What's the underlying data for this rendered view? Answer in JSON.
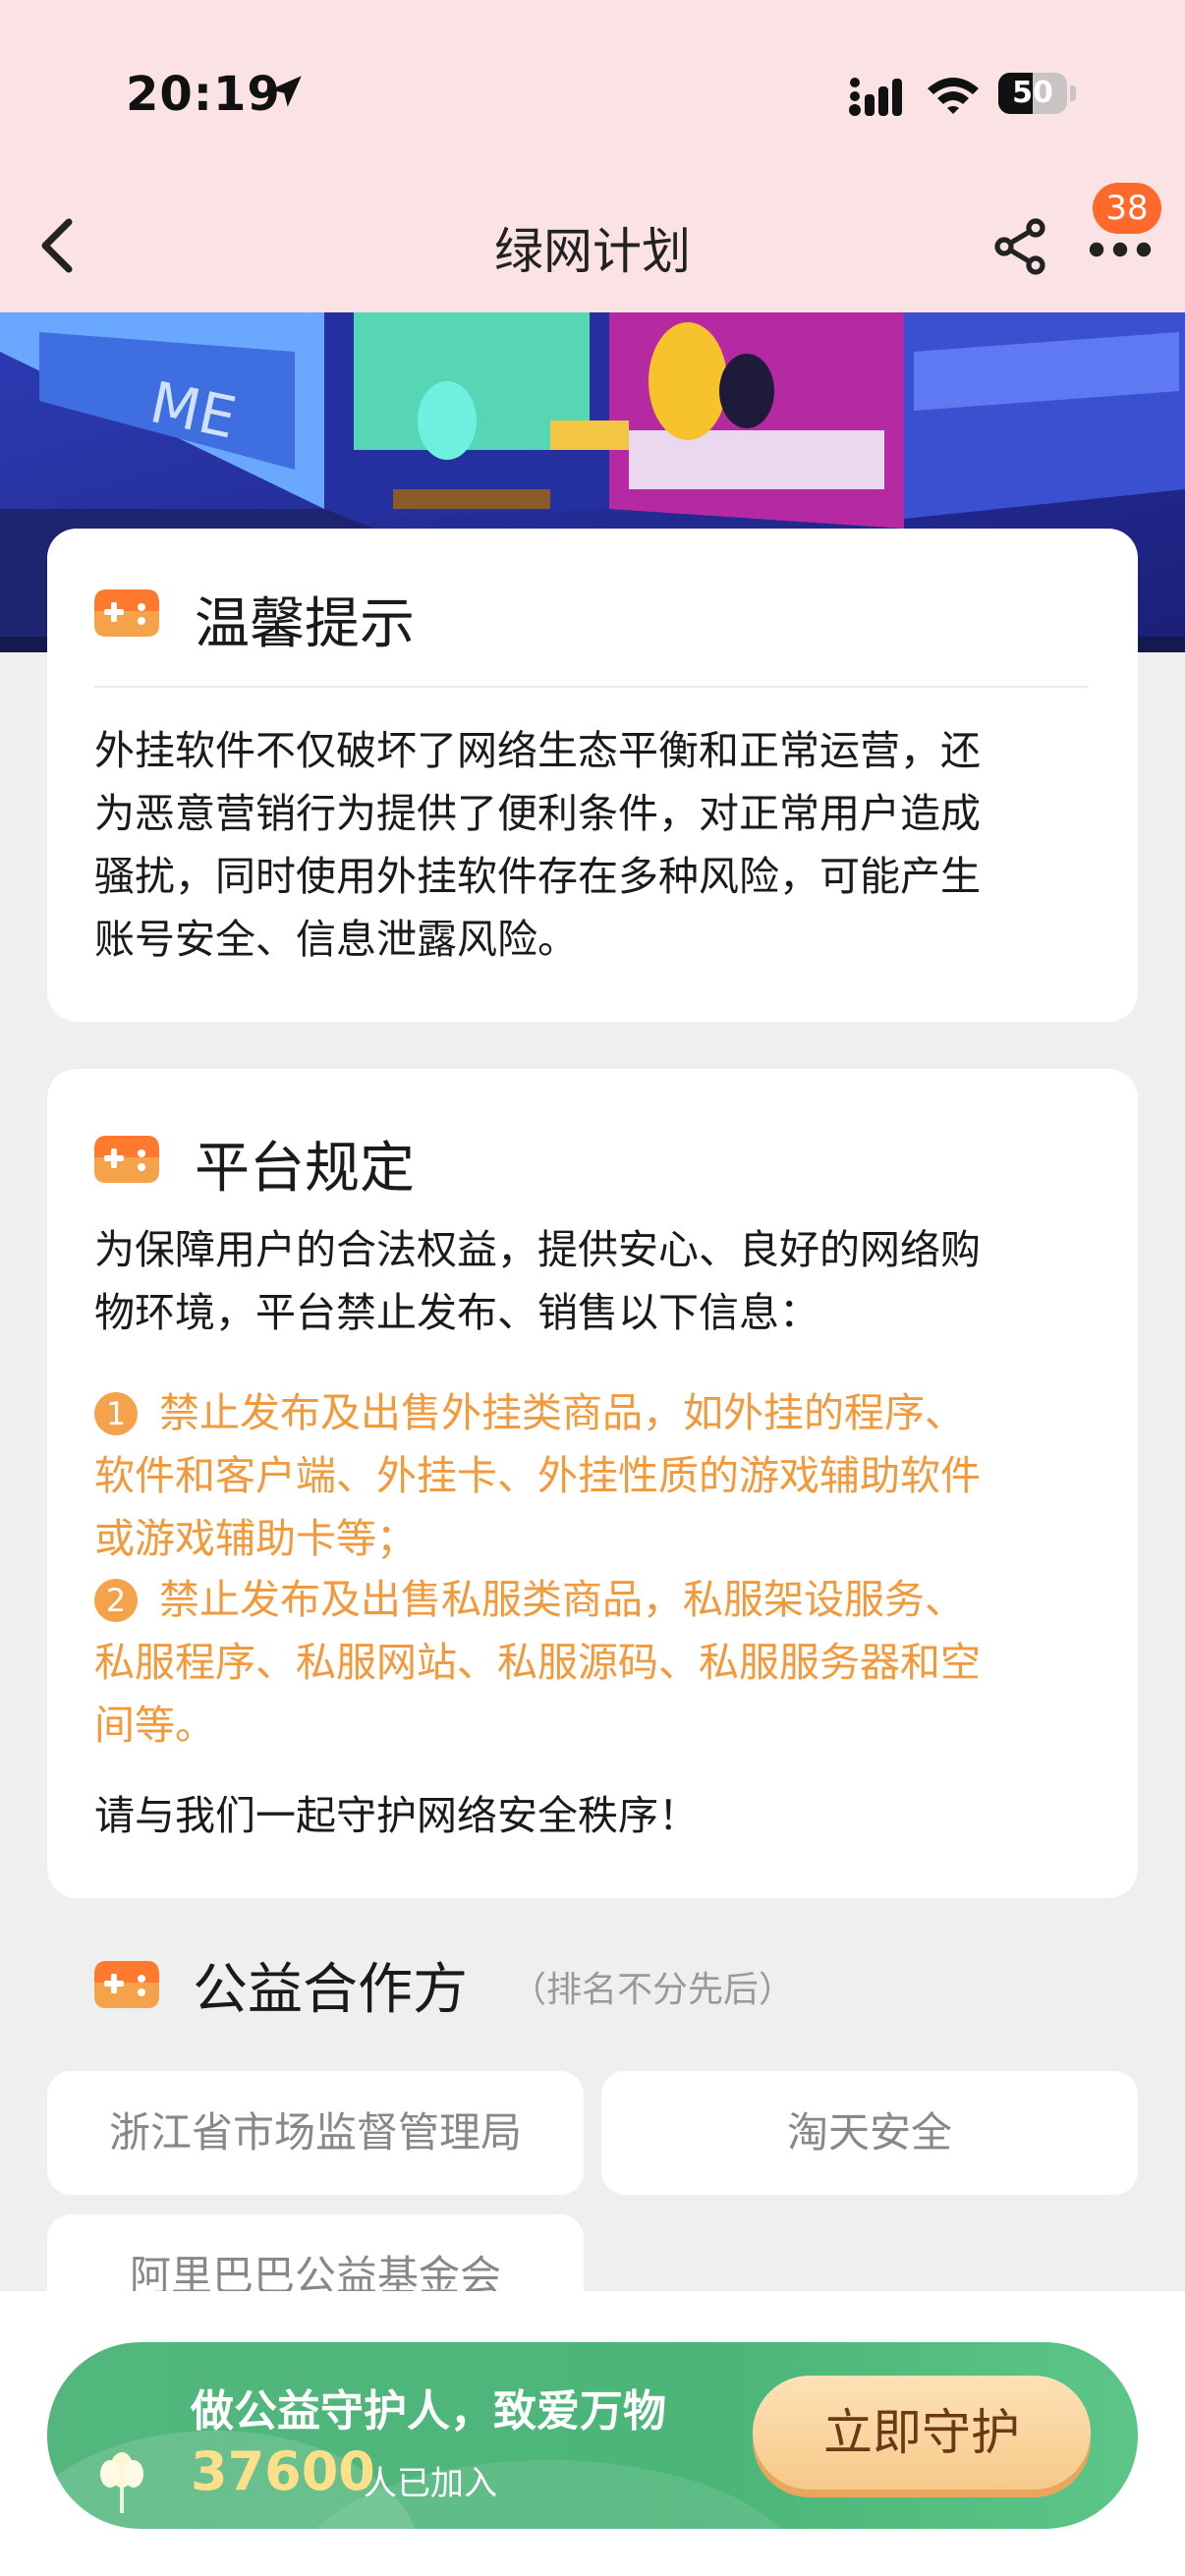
{
  "status_bar": {
    "time": "20:19",
    "battery": "50",
    "battery_level": 0.5
  },
  "nav": {
    "title": "绿网计划",
    "badge": "38"
  },
  "tip_card": {
    "title": "温馨提示",
    "lines": [
      "外挂软件不仅破坏了网络生态平衡和正常运营，还",
      "为恶意营销行为提供了便利条件，对正常用户造成",
      "骚扰，同时使用外挂软件存在多种风险，可能产生",
      "账号安全、信息泄露风险。"
    ]
  },
  "rules_card": {
    "title": "平台规定",
    "intro_lines": [
      "为保障用户的合法权益，提供安心、良好的网络购",
      "物环境，平台禁止发布、销售以下信息："
    ],
    "rules": [
      {
        "num": "1",
        "lines": [
          "禁止发布及出售外挂类商品，如外挂的程序、",
          "软件和客户端、外挂卡、外挂性质的游戏辅助软件",
          "或游戏辅助卡等；"
        ]
      },
      {
        "num": "2",
        "lines": [
          "禁止发布及出售私服类商品，私服架设服务、",
          "私服程序、私服网站、私服源码、私服服务器和空",
          "间等。"
        ]
      }
    ],
    "closing": "请与我们一起守护网络安全秩序！"
  },
  "partners": {
    "title": "公益合作方",
    "note": "（排名不分先后）",
    "items": [
      "浙江省市场监督管理局",
      "淘天安全",
      "阿里巴巴公益基金会"
    ]
  },
  "cta": {
    "title": "做公益守护人，致爱万物",
    "count": "37600",
    "count_suffix": "人已加入",
    "button": "立即守护"
  },
  "colors": {
    "header_bg": "#fbe2e4",
    "page_bg": "#efefef",
    "accent_orange": "#f29a3b",
    "cta_green": "#4bb578"
  },
  "icons": [
    "location-arrow-icon",
    "signal-icon",
    "wifi-icon",
    "battery-icon",
    "back-icon",
    "share-icon",
    "more-icon",
    "gamepad-icon",
    "flower-icon"
  ]
}
